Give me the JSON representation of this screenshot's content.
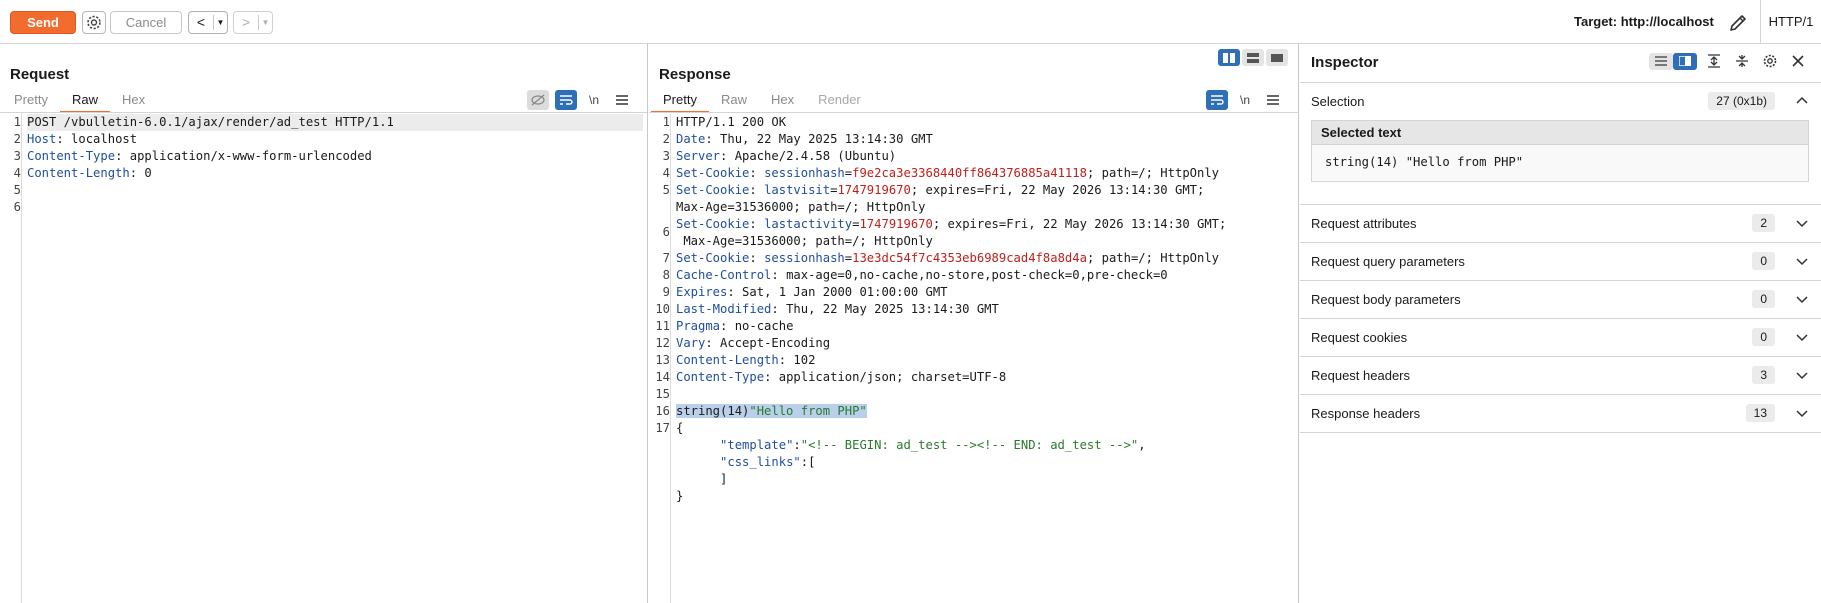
{
  "toolbar": {
    "send": "Send",
    "cancel": "Cancel",
    "prev": "<",
    "next": ">",
    "target": "Target: http://localhost",
    "http_version": "HTTP/1"
  },
  "request": {
    "title": "Request",
    "tabs": [
      "Pretty",
      "Raw",
      "Hex"
    ],
    "active_tab": "Raw",
    "newline_toggle": "\\n",
    "line_numbers": [
      "1",
      "2",
      "3",
      "4",
      "5",
      "6"
    ],
    "lines": [
      {
        "plain": "POST /vbulletin-6.0.1/ajax/render/ad_test HTTP/1.1"
      },
      {
        "key": "Host",
        "val": " localhost"
      },
      {
        "key": "Content-Type",
        "val": " application/x-www-form-urlencoded"
      },
      {
        "key": "Content-Length",
        "val": " 0"
      },
      {
        "plain": ""
      },
      {
        "plain": ""
      }
    ]
  },
  "response": {
    "title": "Response",
    "tabs": [
      "Pretty",
      "Raw",
      "Hex",
      "Render"
    ],
    "active_tab": "Pretty",
    "newline_toggle": "\\n",
    "status_line": "HTTP/1.1 200 OK",
    "headers": [
      {
        "n": "2",
        "key": "Date",
        "val": " Thu, 22 May 2025 13:14:30 GMT"
      },
      {
        "n": "3",
        "key": "Server",
        "val": " Apache/2.4.58 (Ubuntu)"
      },
      {
        "n": "4",
        "key": "Set-Cookie",
        "ckey": "sessionhash",
        "cval": "f9e2ca3e3368440ff864376885a41118",
        "rest": "; path=/; HttpOnly"
      },
      {
        "n": "5",
        "key": "Set-Cookie",
        "ckey": "lastvisit",
        "cval": "1747919670",
        "rest": "; expires=Fri, 22 May 2026 13:14:30 GMT;",
        "cont": "Max-Age=31536000; path=/; HttpOnly"
      },
      {
        "n": "6",
        "key": "Set-Cookie",
        "ckey": "lastactivity",
        "cval": "1747919670",
        "rest": "; expires=Fri, 22 May 2026 13:14:30 GMT;",
        "cont": " Max-Age=31536000; path=/; HttpOnly"
      },
      {
        "n": "7",
        "key": "Set-Cookie",
        "ckey": "sessionhash",
        "cval": "13e3dc54f7c4353eb6989cad4f8a8d4a",
        "rest": "; path=/; HttpOnly"
      },
      {
        "n": "8",
        "key": "Cache-Control",
        "val": " max-age=0,no-cache,no-store,post-check=0,pre-check=0"
      },
      {
        "n": "9",
        "key": "Expires",
        "val": " Sat, 1 Jan 2000 01:00:00 GMT"
      },
      {
        "n": "10",
        "key": "Last-Modified",
        "val": " Thu, 22 May 2025 13:14:30 GMT"
      },
      {
        "n": "11",
        "key": "Pragma",
        "val": " no-cache"
      },
      {
        "n": "12",
        "key": "Vary",
        "val": " Accept-Encoding"
      },
      {
        "n": "13",
        "key": "Content-Length",
        "val": " 102"
      },
      {
        "n": "14",
        "key": "Content-Type",
        "val": " application/json; charset=UTF-8"
      }
    ],
    "body": {
      "line16_plain": "string(14)",
      "line16_str": "\"Hello from PHP\"",
      "open_brace": "{",
      "template_key": "\"template\"",
      "template_val": "\"<!-- BEGIN: ad_test --><!-- END: ad_test -->\"",
      "css_key": "\"css_links\"",
      "css_open": ":[",
      "css_close": "]",
      "close_brace": "}"
    }
  },
  "inspector": {
    "title": "Inspector",
    "selection": {
      "label": "Selection",
      "count": "27 (0x1b)"
    },
    "selected_text_header": "Selected text",
    "selected_text": "string(14) \"Hello from PHP\"",
    "sections": [
      {
        "label": "Request attributes",
        "count": "2"
      },
      {
        "label": "Request query parameters",
        "count": "0"
      },
      {
        "label": "Request body parameters",
        "count": "0"
      },
      {
        "label": "Request cookies",
        "count": "0"
      },
      {
        "label": "Request headers",
        "count": "3"
      },
      {
        "label": "Response headers",
        "count": "13"
      }
    ]
  },
  "colors": {
    "accent": "#f26b2f",
    "toggle_blue": "#2e6fb8",
    "header_key": "#1f4e9c",
    "cookie_value": "#c0201a",
    "json_string": "#2a7a2a"
  }
}
